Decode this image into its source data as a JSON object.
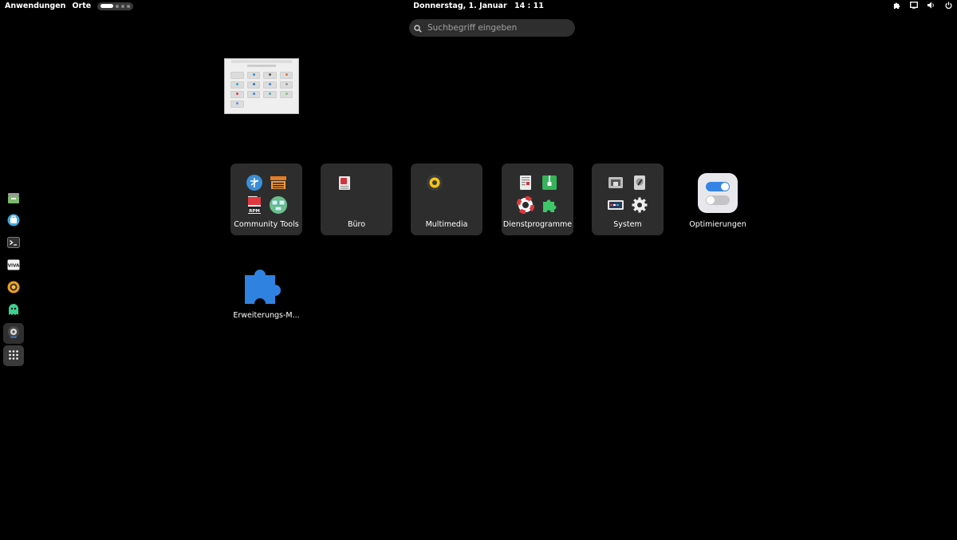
{
  "topbar": {
    "applications": "Anwendungen",
    "places": "Orte",
    "date": "Donnerstag, 1. Januar",
    "time": "14 : 11"
  },
  "search": {
    "placeholder": "Suchbegriff eingeben"
  },
  "window_thumbnail": {
    "title": "Willkommen"
  },
  "dock": {
    "items": [
      {
        "name": "archive-manager-icon"
      },
      {
        "name": "software-installer-icon"
      },
      {
        "name": "terminal-icon"
      },
      {
        "name": "vivaldi-icon"
      },
      {
        "name": "firefox-icon"
      },
      {
        "name": "ghost-app-icon"
      },
      {
        "name": "settings-app-icon"
      },
      {
        "name": "show-apps-icon"
      }
    ]
  },
  "app_grid": {
    "folders": [
      {
        "label": "Community Tools"
      },
      {
        "label": "Büro"
      },
      {
        "label": "Multimedia"
      },
      {
        "label": "Dienstprogramme"
      },
      {
        "label": "System"
      }
    ],
    "apps": [
      {
        "label": "Optimierungen"
      },
      {
        "label": "Erweiterungs-M..."
      }
    ]
  },
  "colors": {
    "background": "#000000",
    "folder_bg": "#2d2d2d",
    "search_bg": "#2e2e2e",
    "accent_blue": "#3584e4"
  }
}
